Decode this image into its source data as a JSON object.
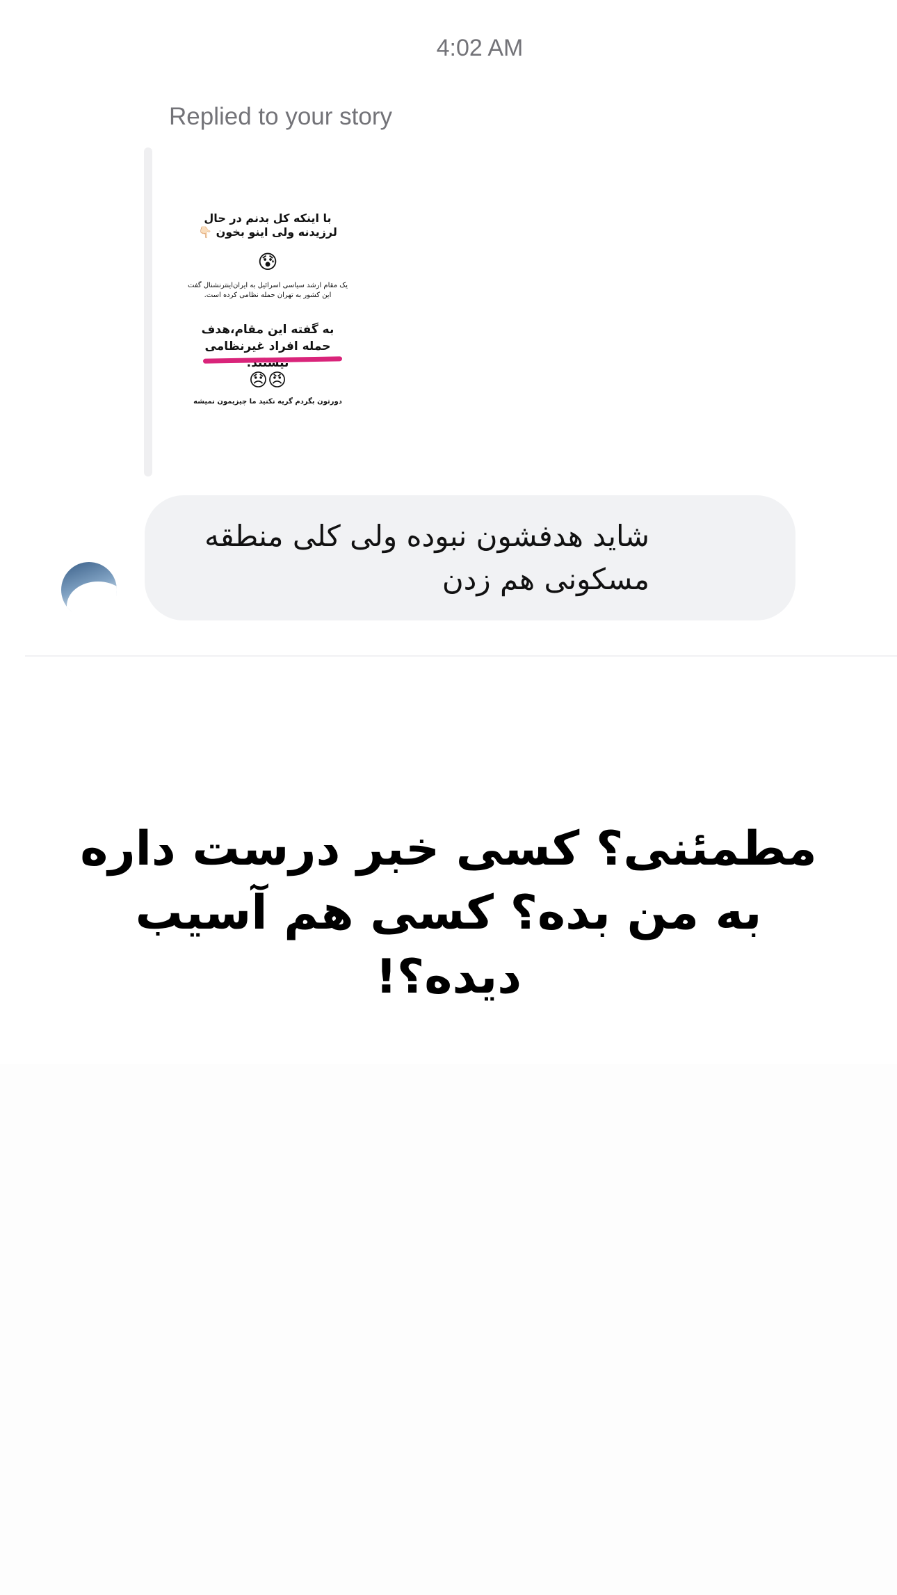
{
  "thread": {
    "timestamp": "4:02 AM",
    "reply_caption": "Replied to your story"
  },
  "story_preview": {
    "line1": "با اینکه کل بدنم در حال لرزیدنه ولی اینو بخون 👇🏻",
    "emoji1": "😰",
    "line2": "یک مقام ارشد سیاسی اسرائیل به ایران‌اینترنشنال گفت این کشور به تهران حمله نظامی کرده است.",
    "line3": "به گفته این مقام،هدف حمله افراد غیرنظامی نیستند.",
    "emoji2": "😠😞",
    "line4": "دورتون بگردم گریه نکنید ما چیزیمون نمیشه",
    "underline_color": "#d9247a"
  },
  "message": {
    "text": "شاید هدفشون نبوده ولی کلی منطقه مسکونی هم زدن"
  },
  "overlay": {
    "text": "مطمئنی؟ کسی خبر درست داره به من بده؟ کسی هم آسیب دیده؟!"
  },
  "colors": {
    "bubble_bg": "#f1f2f4",
    "meta_text": "#737378"
  }
}
